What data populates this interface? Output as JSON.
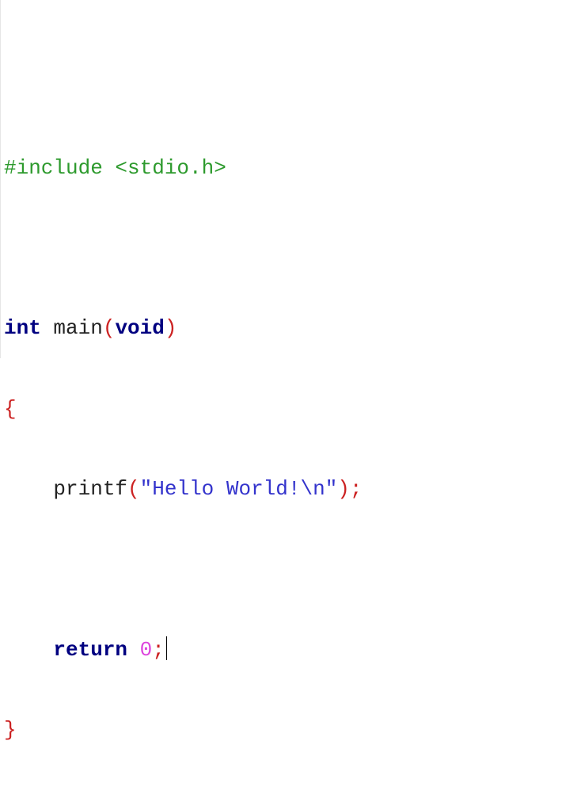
{
  "code": {
    "include_directive": "#include <stdio.h>",
    "type_int": "int",
    "func_name": "main",
    "paren_open": "(",
    "param_void": "void",
    "paren_close": ")",
    "brace_open": "{",
    "indent": "    ",
    "printf_name": "printf",
    "string_literal": "\"Hello World!\\n\"",
    "semicolon": ";",
    "return_keyword": "return",
    "return_value": "0",
    "brace_close": "}"
  },
  "colors": {
    "preprocessor": "#2d9a2d",
    "keyword": "#000080",
    "operator": "#cc2222",
    "string": "#3333cc",
    "number": "#dd44dd",
    "identifier": "#222222"
  }
}
